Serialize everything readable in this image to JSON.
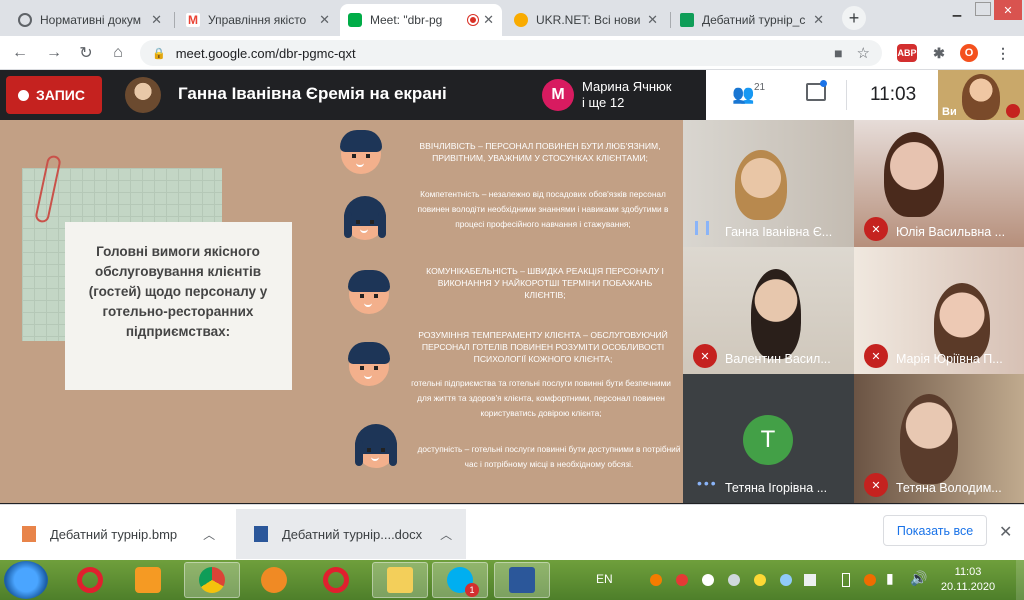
{
  "tabs": [
    {
      "title": "Нормативні докум",
      "icon": "globe-icon",
      "color": "#5f6368"
    },
    {
      "title": "Управління якісто",
      "icon": "gmail-icon",
      "color": "#ea4335"
    },
    {
      "title": "Meet: \"dbr-pg",
      "icon": "meet-icon",
      "color": "#00ac47",
      "active": true
    },
    {
      "title": "UKR.NET: Всі нови",
      "icon": "ukrnet-icon",
      "color": "#f9ab00"
    },
    {
      "title": "Дебатний турнір_с",
      "icon": "classroom-icon",
      "color": "#0f9d58"
    }
  ],
  "address": {
    "url": "meet.google.com/dbr-pgmc-qxt"
  },
  "extensions": {
    "abp": "ABP",
    "profile": "O"
  },
  "meet": {
    "record_label": "ЗАПИС",
    "presenting": "Ганна Іванівна Єремія на екрані",
    "joiner_initial": "M",
    "joiner_line1": "Марина Ячнюк",
    "joiner_line2": "і ще 12",
    "participants_count": "21",
    "time": "11:03",
    "self_label": "Ви"
  },
  "slide": {
    "title": "Головні вимоги якісного обслуговування клієнтів (гостей) щодо персоналу у готельно-ресторанних підприємствах:",
    "items": [
      "ВВІЧЛИВІСТЬ – ПЕРСОНАЛ ПОВИНЕН БУТИ ЛЮБ'ЯЗНИМ, ПРИВІТНИМ, УВАЖНИМ У СТОСУНКАХ КЛІЄНТАМИ;",
      "Компетентність – незалежно від посадових обов'язків персонал повинен володіти необхідними знаннями і навиками здобутими в процесі професійного навчання і стажування;",
      "КОМУНІКАБЕЛЬНІСТЬ – ШВИДКА РЕАКЦІЯ ПЕРСОНАЛУ І ВИКОНАННЯ У НАЙКОРОТШІ ТЕРМІНИ ПОБАЖАНЬ КЛІЄНТІВ;",
      "РОЗУМІННЯ ТЕМПЕРАМЕНТУ КЛІЄНТА – ОБСЛУГОВУЮЧИЙ ПЕРСОНАЛ ГОТЕЛІВ ПОВИНЕН РОЗУМІТИ ОСОБЛИВОСТІ ПСИХОЛОГІЇ КОЖНОГО КЛІЄНТА;",
      "готельні підприємства та готельні послуги повинні бути безпечними для життя та здоров'я клієнта, комфортними, персонал повинен користуватись довірою клієнта;",
      "доступність – готельні послуги повинні бути доступними в потрібний час і потрібному місці в необхідному обсязі."
    ]
  },
  "participants": [
    {
      "name": "Ганна Іванівна Є...",
      "status": "speaking"
    },
    {
      "name": "Юлія Васильвна ...",
      "status": "muted"
    },
    {
      "name": "Валентин Васил...",
      "status": "muted"
    },
    {
      "name": "Марія Юріївна П...",
      "status": "muted"
    },
    {
      "name": "Тетяна Ігорівна ...",
      "status": "no-video",
      "initial": "T",
      "color": "#43a047"
    },
    {
      "name": "Тетяна Володим...",
      "status": "muted"
    }
  ],
  "downloads": [
    {
      "name": "Дебатний турнір.bmp",
      "icon": "image-file-icon"
    },
    {
      "name": "Дебатний турнір....docx",
      "icon": "word-file-icon"
    }
  ],
  "downloads_show_all": "Показать все",
  "taskbar": {
    "lang": "EN",
    "time": "11:03",
    "date": "20.11.2020",
    "skype_badge": "1"
  }
}
